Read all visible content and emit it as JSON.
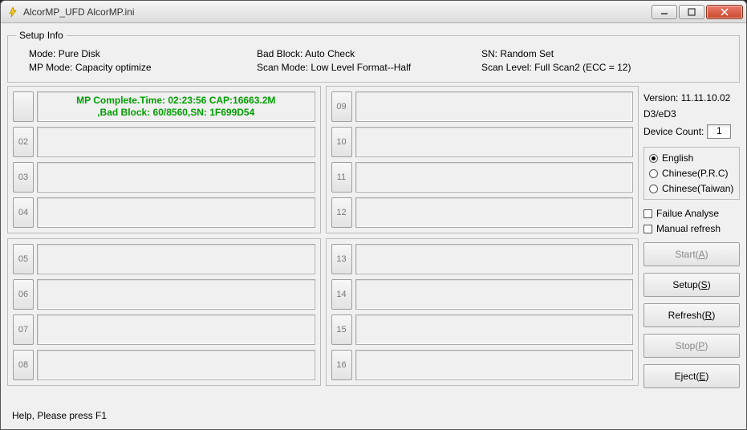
{
  "window": {
    "title": "AlcorMP_UFD     AlcorMP.ini"
  },
  "setup": {
    "legend": "Setup Info",
    "mode_label": "Mode:",
    "mode_value": "Pure Disk",
    "badblock_label": "Bad Block:",
    "badblock_value": "Auto Check",
    "sn_label": "SN:",
    "sn_value": "Random Set",
    "mpmode_label": "MP Mode:",
    "mpmode_value": "Capacity optimize",
    "scanmode_label": "Scan Mode:",
    "scanmode_value": "Low Level Format--Half",
    "scanlevel_label": "Scan Level:",
    "scanlevel_value": "Full Scan2 (ECC = 12)"
  },
  "slots": {
    "s01_line1": "MP Complete.Time: 02:23:56 CAP:16663.2M",
    "s01_line2": ",Bad Block: 60/8560,SN: 1F699D54",
    "n02": "02",
    "n03": "03",
    "n04": "04",
    "n05": "05",
    "n06": "06",
    "n07": "07",
    "n08": "08",
    "n09": "09",
    "n10": "10",
    "n11": "11",
    "n12": "12",
    "n13": "13",
    "n14": "14",
    "n15": "15",
    "n16": "16"
  },
  "side": {
    "version_label": "Version:",
    "version": "11.11.10.02",
    "chip": "D3/eD3",
    "devcount_label": "Device Count:",
    "devcount": "1",
    "lang_en": "English",
    "lang_prc": "Chinese(P.R.C)",
    "lang_tw": "Chinese(Taiwan)",
    "failue": "Failue Analyse",
    "manual": "Manual refresh",
    "start": "Start(",
    "start_u": "A",
    "start_end": ")",
    "setup": "Setup(",
    "setup_u": "S",
    "setup_end": ")",
    "refresh": "Refresh(",
    "refresh_u": "R",
    "refresh_end": ")",
    "stop": "Stop(",
    "stop_u": "P",
    "stop_end": ")",
    "eject": "Eject(",
    "eject_u": "E",
    "eject_end": ")"
  },
  "footer": "Help, Please press F1"
}
